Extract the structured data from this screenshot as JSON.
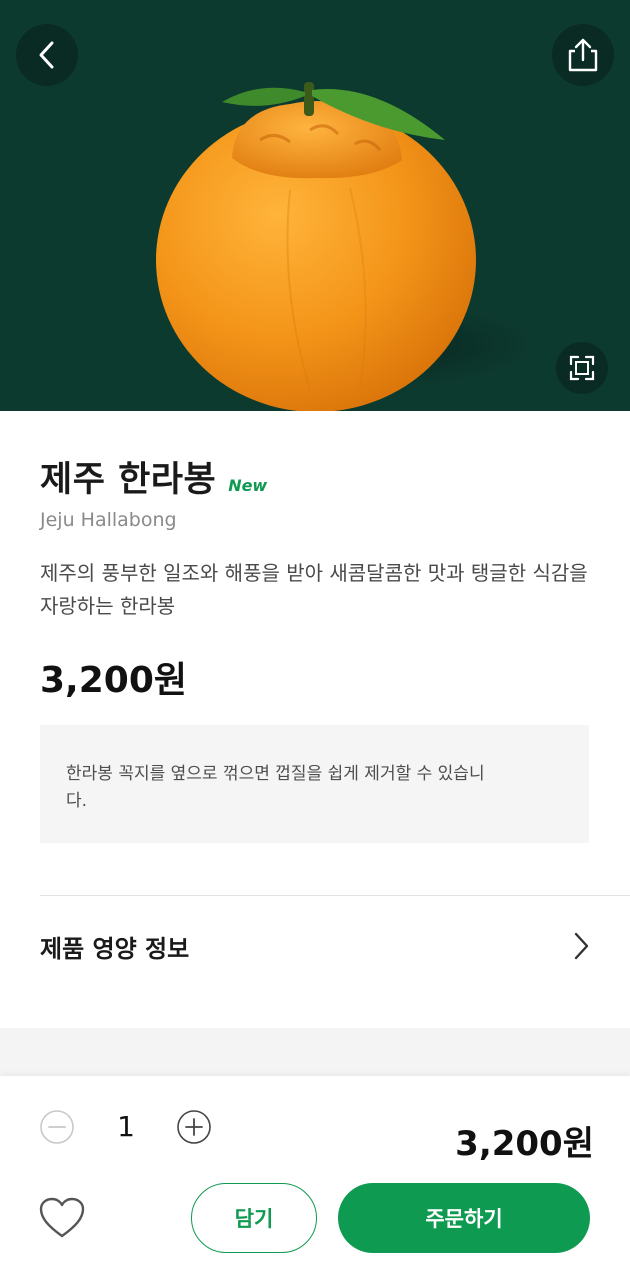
{
  "header": {
    "back_icon": "chevron-left-icon",
    "share_icon": "share-icon",
    "zoom_icon": "fullscreen-icon"
  },
  "product": {
    "name": "제주 한라봉",
    "badge": "New",
    "english_name": "Jeju Hallabong",
    "description": "제주의 풍부한 일조와 해풍을 받아 새콤달콤한 맛과 탱글한 식감을 자랑하는 한라봉",
    "price": "3,200원",
    "notice": "한라봉 꼭지를 옆으로 꺾으면 껍질을 쉽게 제거할 수 있습니다."
  },
  "nutrition": {
    "label": "제품 영양 정보"
  },
  "order_bar": {
    "quantity": "1",
    "total_price": "3,200원",
    "cart_label": "담기",
    "order_label": "주문하기"
  },
  "colors": {
    "hero_background": "#0d3a2f",
    "accent_green": "#0f9a52",
    "orange": "#f49a1c"
  }
}
